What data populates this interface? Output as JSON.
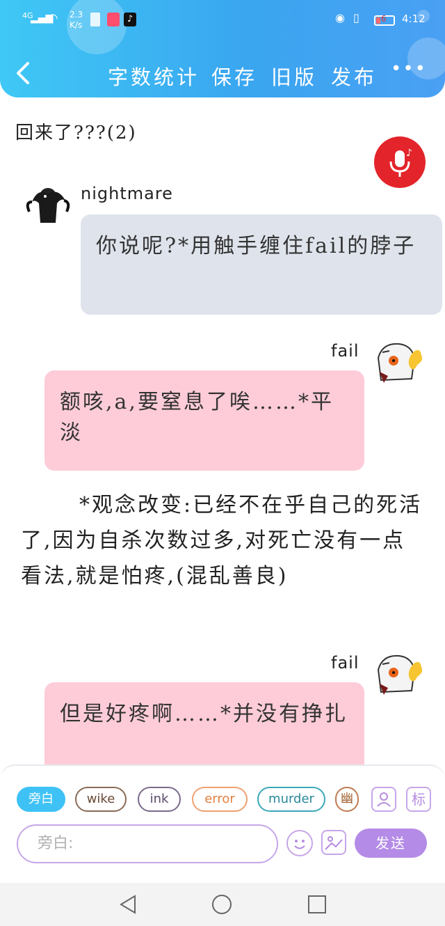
{
  "status_bar": {
    "signal": "4G",
    "speed": "2.3 K/s",
    "battery": "6",
    "time": "4:12",
    "speed_top": "2.3",
    "speed_unit": "K/s"
  },
  "header": {
    "back_icon": "chevron-left-icon",
    "actions": [
      "字数统计",
      "保存",
      "旧版",
      "发布"
    ],
    "more_icon": "more-dots-icon"
  },
  "story": {
    "title": "回来了???(2)",
    "messages": [
      {
        "speaker": "nightmare",
        "text": "你说呢?*用触手缠住fail的脖子",
        "side": "left"
      },
      {
        "speaker": "fail",
        "text": "额咳,a,要窒息了唉……*平淡",
        "side": "right"
      }
    ],
    "narration": "*观念改变:已经不在乎自己的死活了,因为自杀次数过多,对死亡没有一点看法,就是怕疼,(混乱善良)",
    "last_message": {
      "speaker": "fail",
      "text": "但是好疼啊……*并没有挣扎",
      "side": "right"
    }
  },
  "composer": {
    "roles": [
      "旁白",
      "wike",
      "ink",
      "error",
      "murder",
      "幽"
    ],
    "role_colors": [
      "#3ec2f5",
      "#8a6a55",
      "#7a6a8a",
      "#f0a070",
      "#3aa8b8",
      "#c07a50"
    ],
    "placeholder": "旁白:",
    "send_label": "发送",
    "tool_icons": [
      "contact-card-icon",
      "tag-icon"
    ],
    "tag_label": "标",
    "emoji_icon": "smiley-icon",
    "image_icon": "image-icon"
  },
  "colors": {
    "header": "#3aa6f0",
    "grey_bubble": "#dfe4ec",
    "pink_bubble": "#fdccd8",
    "accent_purple": "#b48be6"
  }
}
